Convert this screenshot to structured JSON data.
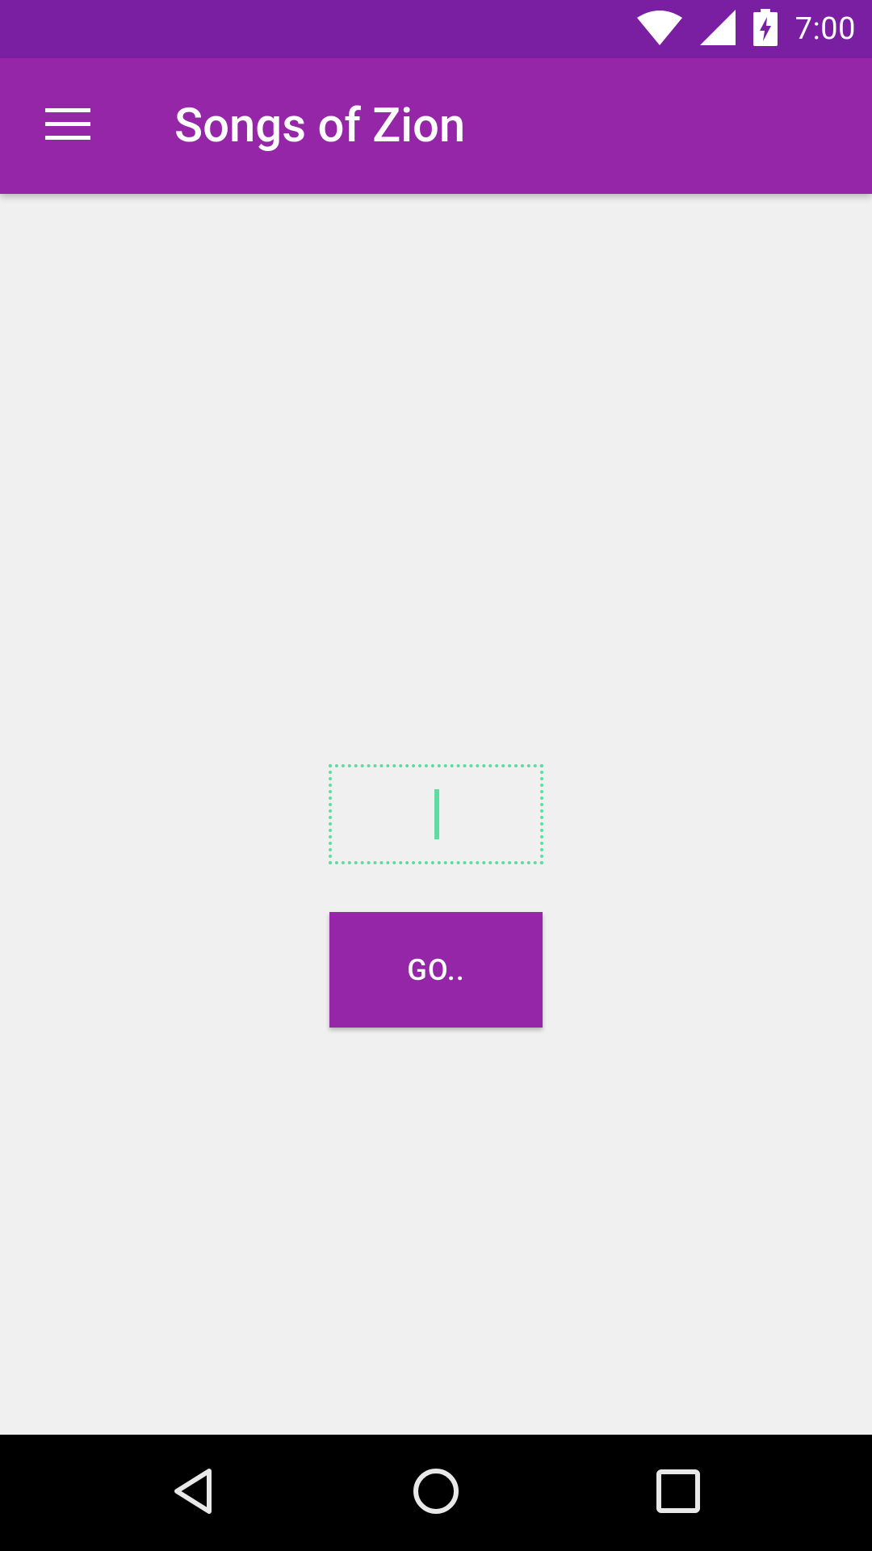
{
  "status_bar": {
    "time": "7:00",
    "icons": [
      "wifi-icon",
      "cell-signal-icon",
      "battery-charging-icon"
    ]
  },
  "app_bar": {
    "menu_icon": "hamburger-menu-icon",
    "title": "Songs of Zion"
  },
  "main": {
    "number_input": {
      "value": "",
      "placeholder": ""
    },
    "go_button_label": "GO.."
  },
  "nav_bar": {
    "icons": [
      "back-icon",
      "home-icon",
      "recents-icon"
    ]
  },
  "colors": {
    "status_bar": "#7b1fa2",
    "primary": "#9526a8",
    "accent": "#5fdc9f",
    "background": "#f0f0f0"
  }
}
